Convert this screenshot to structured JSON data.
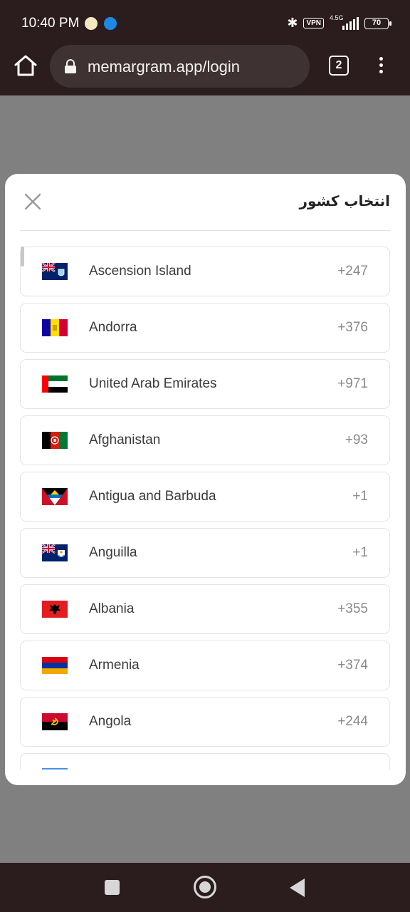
{
  "status_bar": {
    "time": "10:40 PM",
    "vpn_label": "VPN",
    "network_label": "4.5G",
    "battery_level": "70"
  },
  "browser": {
    "url": "memargram.app/login",
    "tab_count": "2"
  },
  "modal": {
    "title": "انتخاب کشور",
    "countries": [
      {
        "name": "Ascension Island",
        "code": "+247",
        "flag": "ascension-flag"
      },
      {
        "name": "Andorra",
        "code": "+376",
        "flag": "andorra-flag"
      },
      {
        "name": "United Arab Emirates",
        "code": "+971",
        "flag": "uae-flag"
      },
      {
        "name": "Afghanistan",
        "code": "+93",
        "flag": "afghanistan-flag"
      },
      {
        "name": "Antigua and Barbuda",
        "code": "+1",
        "flag": "antigua-flag"
      },
      {
        "name": "Anguilla",
        "code": "+1",
        "flag": "anguilla-flag"
      },
      {
        "name": "Albania",
        "code": "+355",
        "flag": "albania-flag"
      },
      {
        "name": "Armenia",
        "code": "+374",
        "flag": "armenia-flag"
      },
      {
        "name": "Angola",
        "code": "+244",
        "flag": "angola-flag"
      }
    ]
  },
  "colors": {
    "system_bar": "#2b1d1d",
    "overlay": "#808080",
    "modal_bg": "#ffffff"
  }
}
